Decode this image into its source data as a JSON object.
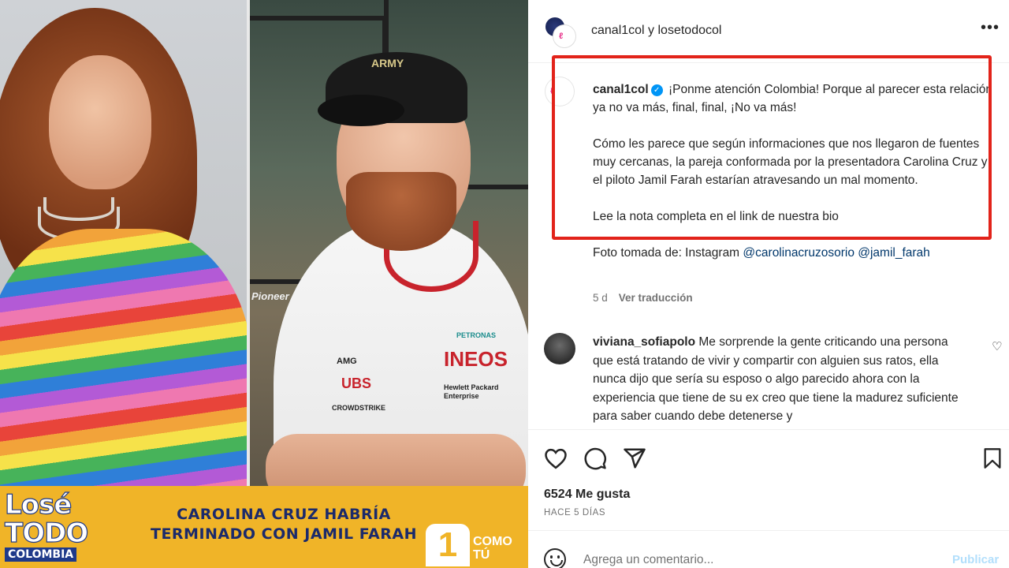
{
  "header": {
    "title": "canal1col y losetodocol",
    "more_icon": "more-horizontal-icon"
  },
  "post": {
    "username": "canal1col",
    "verified": true,
    "caption_line1": "¡Ponme atención Colombia! Porque al parecer esta relación ya no va más, final, final, ¡No va más!",
    "caption_para2": "Cómo les parece que según informaciones que nos llegaron de fuentes muy cercanas, la pareja conformada por la presentadora Carolina Cruz y el piloto Jamil Farah estarían atravesando un mal momento.",
    "caption_para3": "Lee la nota completa en el link de nuestra bio",
    "caption_para4_prefix": "Foto tomada de: Instagram",
    "mention1": "@carolinacruzosorio",
    "mention2": "@jamil_farah",
    "time": "5 d",
    "translate_label": "Ver traducción"
  },
  "comment": {
    "username": "viviana_sofiapolo",
    "text": "Me sorprende la gente criticando una persona que está tratando de vivir y compartir con alguien sus ratos, ella nunca dijo que sería su esposo o algo parecido ahora con la experiencia que tiene de su ex creo que tiene la madurez suficiente para saber cuando debe detenerse y"
  },
  "actions": {
    "like_icon": "heart-icon",
    "comment_icon": "comment-icon",
    "share_icon": "send-icon",
    "save_icon": "bookmark-icon"
  },
  "likes": "6524 Me gusta",
  "timeago": "HACE 5 DÍAS",
  "add_comment": {
    "placeholder": "Agrega un comentario...",
    "publish_label": "Publicar"
  },
  "banner": {
    "logo_line1": "Losé",
    "logo_line2": "TODO",
    "logo_line3": "COLOMBIA",
    "headline": "CAROLINA CRUZ HABRÍA TERMINADO CON JAMIL FARAH",
    "channel_mark": "1",
    "channel_line1": "COMO",
    "channel_line2": "TÚ"
  },
  "photo_text": {
    "cap_text": "ARMY",
    "shirt_brand1": "PETRONAS",
    "shirt_brand2": "INEOS",
    "shirt_brand3": "UBS",
    "shirt_brand4": "CROWDSTRIKE",
    "shirt_brand5": "Hewlett Packard Enterprise",
    "shirt_brand6": "AMG",
    "background_sign": "Pioneer"
  },
  "colors": {
    "highlight_border": "#e2231a",
    "banner_yellow": "#f0b428",
    "banner_text": "#1b2a6b",
    "mention_blue": "#00376b",
    "verified_blue": "#0095f6"
  }
}
